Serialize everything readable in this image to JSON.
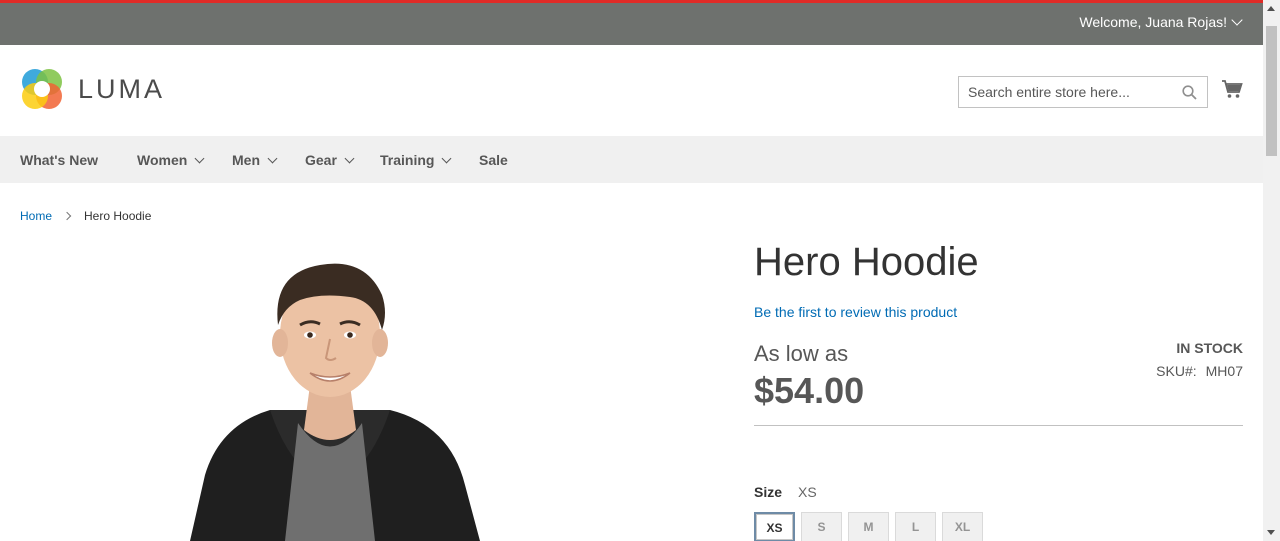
{
  "topbar": {
    "welcome": "Welcome, Juana Rojas!",
    "accent": "#e02b27",
    "bg": "#6e716e"
  },
  "header": {
    "logo_text": "LUMA",
    "search": {
      "placeholder": "Search entire store here...",
      "value": ""
    },
    "icons": {
      "search": "search-icon",
      "cart": "cart-icon"
    }
  },
  "nav": {
    "items": [
      {
        "label": "What's New",
        "has_dropdown": false
      },
      {
        "label": "Women",
        "has_dropdown": true
      },
      {
        "label": "Men",
        "has_dropdown": true
      },
      {
        "label": "Gear",
        "has_dropdown": true
      },
      {
        "label": "Training",
        "has_dropdown": true
      },
      {
        "label": "Sale",
        "has_dropdown": false
      }
    ]
  },
  "breadcrumb": {
    "home": "Home",
    "current": "Hero Hoodie"
  },
  "product": {
    "name": "Hero Hoodie",
    "review_link": "Be the first to review this product",
    "price_prefix": "As low as",
    "price": "$54.00",
    "stock": "In stock",
    "sku_label": "SKU#:",
    "sku": "MH07",
    "size": {
      "label": "Size",
      "selected": "XS",
      "options": [
        "XS",
        "S",
        "M",
        "L",
        "XL"
      ]
    }
  }
}
